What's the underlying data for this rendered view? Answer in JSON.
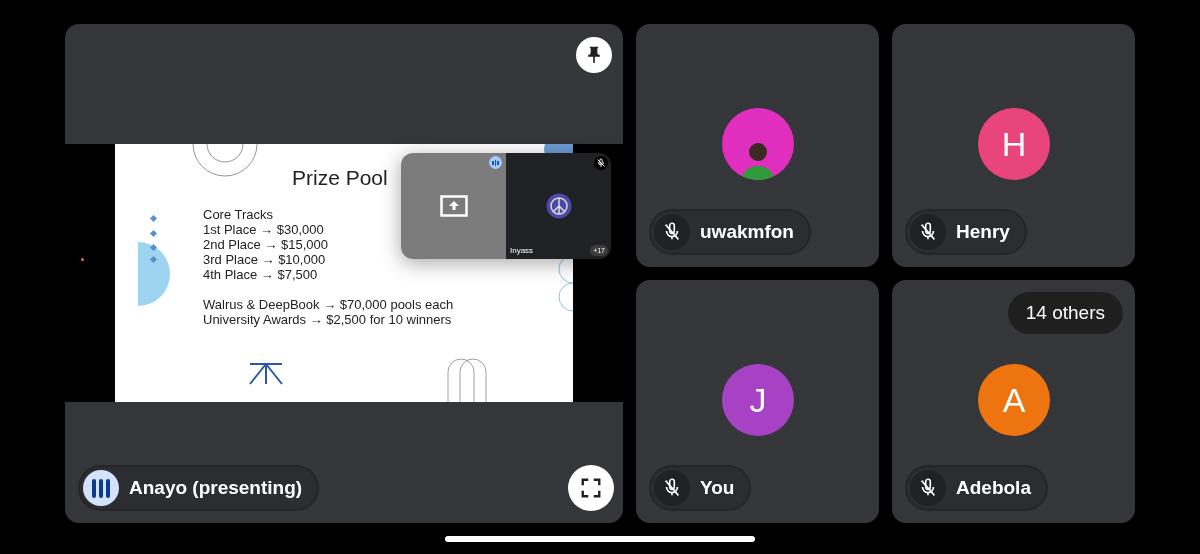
{
  "presenter": {
    "name": "Anayo (presenting)",
    "speaking": true,
    "slide": {
      "title": "Prize Pool",
      "groups": [
        {
          "lines": [
            "Core Tracks",
            "1st Place → $30,000",
            "2nd Place → $15,000",
            "3rd Place → $10,000",
            "4th Place → $7,500"
          ]
        },
        {
          "lines": [
            "Walrus & DeepBook → $70,000 pools each",
            "University Awards → $2,500 for 10 winners"
          ]
        }
      ]
    },
    "pip": {
      "name": "Inyass",
      "count": "+17",
      "muted": true
    }
  },
  "participants": [
    {
      "name": "uwakmfon",
      "kind": "picture",
      "color": "#e02fbf",
      "muted": true
    },
    {
      "name": "Henry",
      "kind": "initial",
      "initial": "H",
      "color": "#e8457c",
      "muted": true
    },
    {
      "name": "You",
      "kind": "initial",
      "initial": "J",
      "color": "#a842c4",
      "muted": true
    },
    {
      "name": "Adebola",
      "kind": "initial",
      "initial": "A",
      "color": "#ee7410",
      "muted": true,
      "badge": "14 others"
    }
  ]
}
